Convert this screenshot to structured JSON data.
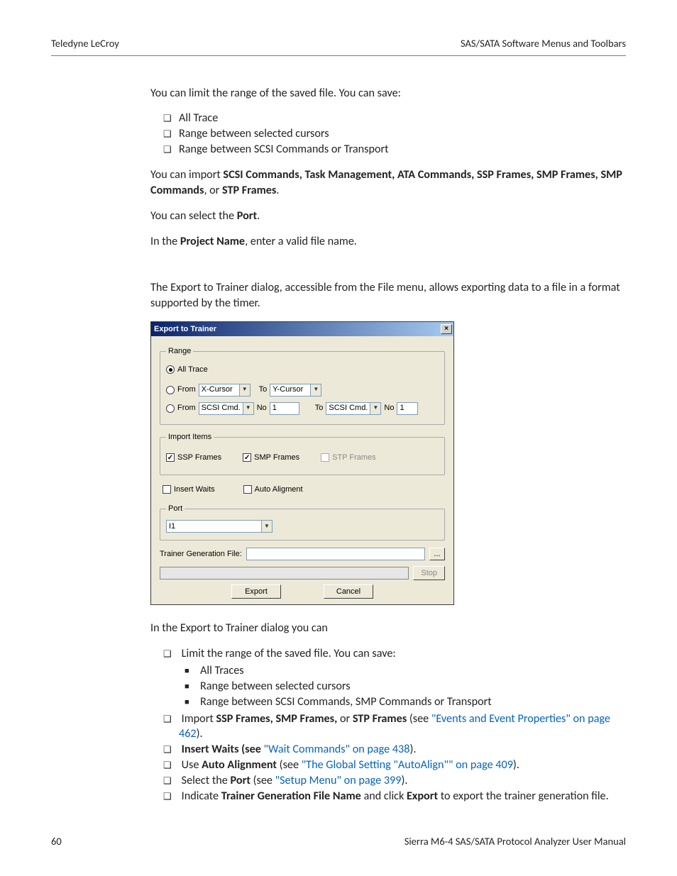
{
  "header": {
    "left": "Teledyne LeCroy",
    "right": "SAS/SATA Software Menus and Toolbars"
  },
  "para": {
    "p1": "You can limit the range of the saved file. You can save:",
    "list1": [
      "All Trace",
      "Range between selected cursors",
      "Range between SCSI Commands or Transport"
    ],
    "p2a": "You can import ",
    "p2b": "SCSI Commands, Task Management, ATA Commands, SSP Frames, SMP Frames, SMP Commands",
    "p2c": ", or ",
    "p2d": "STP Frames",
    "p2e": ".",
    "p3a": "You can select the ",
    "p3b": "Port",
    "p3c": ".",
    "p4a": "In the ",
    "p4b": "Project Name",
    "p4c": ", enter a valid file name.",
    "p5": "The Export to Trainer dialog, accessible from the File menu, allows exporting data to a file in a format supported by the timer.",
    "p6": "In the Export to Trainer dialog you can",
    "b_limit": "Limit the range of the saved file. You can save:",
    "sub_limit": [
      "All Traces",
      "Range between selected cursors",
      "Range between SCSI Commands, SMP Commands or Transport"
    ],
    "b_import_a": "Import ",
    "b_import_b": "SSP Frames, SMP Frames,",
    "b_import_c": " or ",
    "b_import_d": "STP Frames",
    "b_import_e": " (see ",
    "b_import_link": "\"Events and Event Properties\" on page 462",
    "b_import_f": ").",
    "b_wait_a": "Insert Waits (see ",
    "b_wait_link": "\"Wait Commands\" on page 438",
    "b_wait_b": ").",
    "b_auto_a": "Use ",
    "b_auto_b": "Auto Alignment",
    "b_auto_c": " (see ",
    "b_auto_link": "\"The Global Setting \"AutoAlign\"\" on page 409",
    "b_auto_d": ").",
    "b_port_a": "Select the ",
    "b_port_b": "Port",
    "b_port_c": " (see ",
    "b_port_link": "\"Setup Menu\" on page 399",
    "b_port_d": ").",
    "b_tgf_a": "Indicate ",
    "b_tgf_b": "Trainer Generation File Name",
    "b_tgf_c": " and click ",
    "b_tgf_d": "Export",
    "b_tgf_e": " to export the trainer generation file."
  },
  "dialog": {
    "title": "Export to Trainer",
    "range": {
      "legend": "Range",
      "all_trace": "All Trace",
      "from": "From",
      "to": "To",
      "no": "No",
      "xcursor": "X-Cursor",
      "ycursor": "Y-Cursor",
      "scsi": "SCSI Cmd.",
      "no1": "1"
    },
    "import": {
      "legend": "Import Items",
      "ssp": "SSP Frames",
      "smp": "SMP Frames",
      "stp": "STP Frames"
    },
    "insert_waits": "Insert Waits",
    "auto_align": "Auto Aligment",
    "port": {
      "legend": "Port",
      "value": "I1"
    },
    "tgf_label": "Trainer Generation File:",
    "browse": "...",
    "stop": "Stop",
    "export": "Export",
    "cancel": "Cancel"
  },
  "footer": {
    "left": "60",
    "right": "Sierra M6-4 SAS/SATA Protocol Analyzer User Manual"
  }
}
